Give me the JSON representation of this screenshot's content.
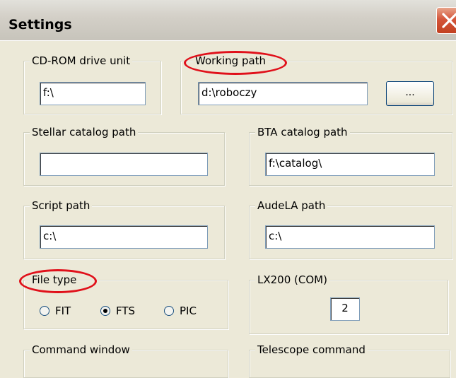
{
  "window": {
    "title": "Settings"
  },
  "groups": {
    "cdrom": {
      "label": "CD-ROM drive unit",
      "value": "f:\\"
    },
    "working": {
      "label": "Working path",
      "value": "d:\\roboczy",
      "browse_label": "..."
    },
    "stellar": {
      "label": "Stellar catalog path",
      "value": ""
    },
    "bta": {
      "label": "BTA catalog path",
      "value": "f:\\catalog\\"
    },
    "script": {
      "label": "Script path",
      "value": "c:\\"
    },
    "audela": {
      "label": "AudeLA path",
      "value": "c:\\"
    },
    "filetype": {
      "label": "File type",
      "options": [
        {
          "label": "FIT",
          "checked": false
        },
        {
          "label": "FTS",
          "checked": true
        },
        {
          "label": "PIC",
          "checked": false
        }
      ]
    },
    "lx200": {
      "label": "LX200 (COM)",
      "value": "2"
    },
    "command": {
      "label": "Command window"
    },
    "telescope": {
      "label": "Telescope command"
    }
  },
  "icons": {
    "close": "close-icon"
  },
  "colors": {
    "highlight": "#e0101a"
  }
}
